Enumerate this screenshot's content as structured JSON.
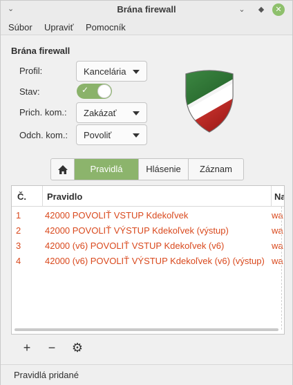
{
  "window": {
    "title": "Brána firewall",
    "menu_icon": "chevron-down-icon",
    "minimize_icon": "chevron-down-icon",
    "maximize_icon": "diamond-icon",
    "close_icon": "close-icon",
    "accent": "#8cb46c"
  },
  "menubar": {
    "items": [
      "Súbor",
      "Upraviť",
      "Pomocník"
    ]
  },
  "main": {
    "section_title": "Brána firewall",
    "profile_label": "Profil:",
    "profile_value": "Kancelária",
    "status_label": "Stav:",
    "status_enabled": true,
    "incoming_label": "Prich. kom.:",
    "incoming_value": "Zakázať",
    "outgoing_label": "Odch. kom.:",
    "outgoing_value": "Povoliť"
  },
  "tabs": {
    "home_icon": "home-icon",
    "items": [
      "Pravidlá",
      "Hlásenie",
      "Záznam"
    ],
    "active": "Pravidlá"
  },
  "table": {
    "columns": [
      "Č.",
      "Pravidlo",
      "Na"
    ],
    "rows": [
      {
        "num": "1",
        "rule": "42000 POVOLIŤ VSTUP Kdekoľvek",
        "name": "wa"
      },
      {
        "num": "2",
        "rule": "42000 POVOLIŤ VÝSTUP Kdekoľvek (výstup)",
        "name": "wa"
      },
      {
        "num": "3",
        "rule": "42000 (v6) POVOLIŤ VSTUP Kdekoľvek (v6)",
        "name": "wa"
      },
      {
        "num": "4",
        "rule": "42000 (v6) POVOLIŤ VÝSTUP Kdekoľvek (v6) (výstup)",
        "name": "wa"
      }
    ],
    "row_color": "#d9481c"
  },
  "toolbar": {
    "add_label": "+",
    "remove_label": "−",
    "settings_icon": "gear-icon"
  },
  "statusbar": {
    "text": "Pravidlá pridané"
  }
}
